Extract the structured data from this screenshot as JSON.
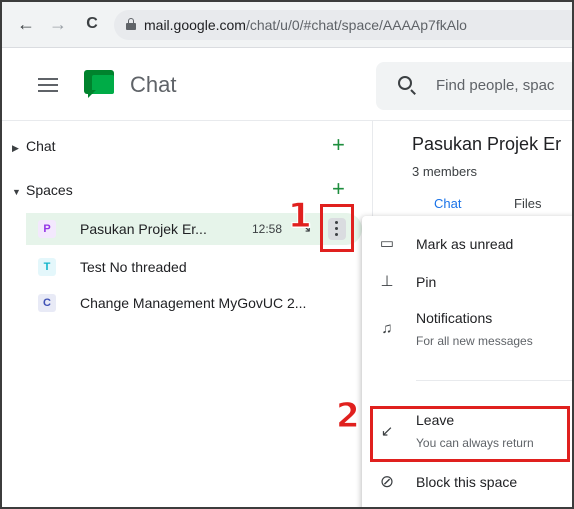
{
  "browser": {
    "back": "←",
    "forward": "→",
    "reload": "C",
    "url_host": "mail.google.com",
    "url_path": "/chat/u/0/#chat/space/AAAAp7fkAlo"
  },
  "header": {
    "app_title": "Chat",
    "search_placeholder": "Find people, spac"
  },
  "sidebar": {
    "chat_section": "Chat",
    "spaces_section": "Spaces",
    "plus": "+",
    "spaces": [
      {
        "avatar": "P",
        "label": "Pasukan Projek Er...",
        "time": "12:58",
        "avatar_bg": "#f3e8fd",
        "avatar_fg": "#9334e6"
      },
      {
        "avatar": "T",
        "label": "Test No threaded",
        "avatar_bg": "#e4f7fb",
        "avatar_fg": "#12b5cb"
      },
      {
        "avatar": "C",
        "label": "Change Management MyGovUC 2...",
        "avatar_bg": "#e8eaf6",
        "avatar_fg": "#3f51b5"
      }
    ]
  },
  "content": {
    "space_title": "Pasukan Projek Er",
    "members": "3 members",
    "tab_chat": "Chat",
    "tab_files": "Files"
  },
  "menu": {
    "mark_unread": "Mark as unread",
    "pin": "Pin",
    "notifications": "Notifications",
    "notifications_sub": "For all new messages",
    "leave": "Leave",
    "leave_sub": "You can always return",
    "block": "Block this space"
  },
  "annotations": {
    "step1": "1",
    "step2": "2"
  },
  "colors": {
    "accent": "#1a73e8",
    "highlight": "#e0201e",
    "active_row": "#e6f4ea",
    "plus_green": "#1e8e3e"
  }
}
